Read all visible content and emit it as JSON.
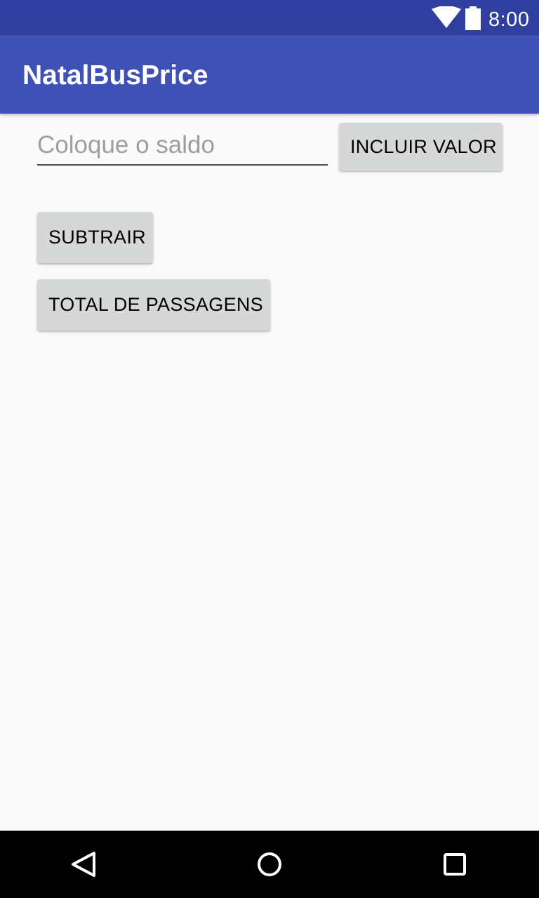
{
  "status_bar": {
    "time": "8:00",
    "icons": [
      "wifi-icon",
      "battery-icon"
    ],
    "color": "#303f9f"
  },
  "app_bar": {
    "title": "NatalBusPrice",
    "color": "#3f51b5"
  },
  "form": {
    "balance_input": {
      "value": "",
      "placeholder": "Coloque o saldo"
    },
    "add_value_label": "INCLUIR VALOR",
    "subtract_label": "SUBTRAIR",
    "total_fares_label": "TOTAL DE PASSAGENS"
  },
  "nav_bar": {
    "icons": [
      "back-icon",
      "home-icon",
      "recents-icon"
    ]
  }
}
